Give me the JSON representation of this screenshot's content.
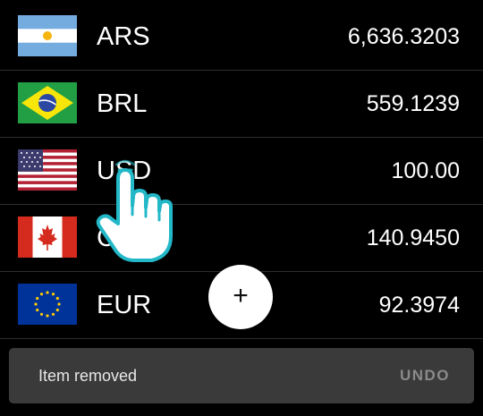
{
  "currencies": [
    {
      "code": "ARS",
      "amount": "6,636.3203",
      "flag_icon": "argentina-flag-icon"
    },
    {
      "code": "BRL",
      "amount": "559.1239",
      "flag_icon": "brazil-flag-icon"
    },
    {
      "code": "USD",
      "amount": "100.00",
      "flag_icon": "usa-flag-icon"
    },
    {
      "code": "CAD",
      "amount": "140.9450",
      "flag_icon": "canada-flag-icon"
    },
    {
      "code": "EUR",
      "amount": "92.3974",
      "flag_icon": "eu-flag-icon"
    }
  ],
  "fab": {
    "label": "+",
    "icon": "plus-icon"
  },
  "snackbar": {
    "message": "Item removed",
    "action": "UNDO"
  },
  "colors": {
    "background": "#000000",
    "snackbar": "#3a3a3a",
    "hand_outline": "#22b8c8"
  }
}
